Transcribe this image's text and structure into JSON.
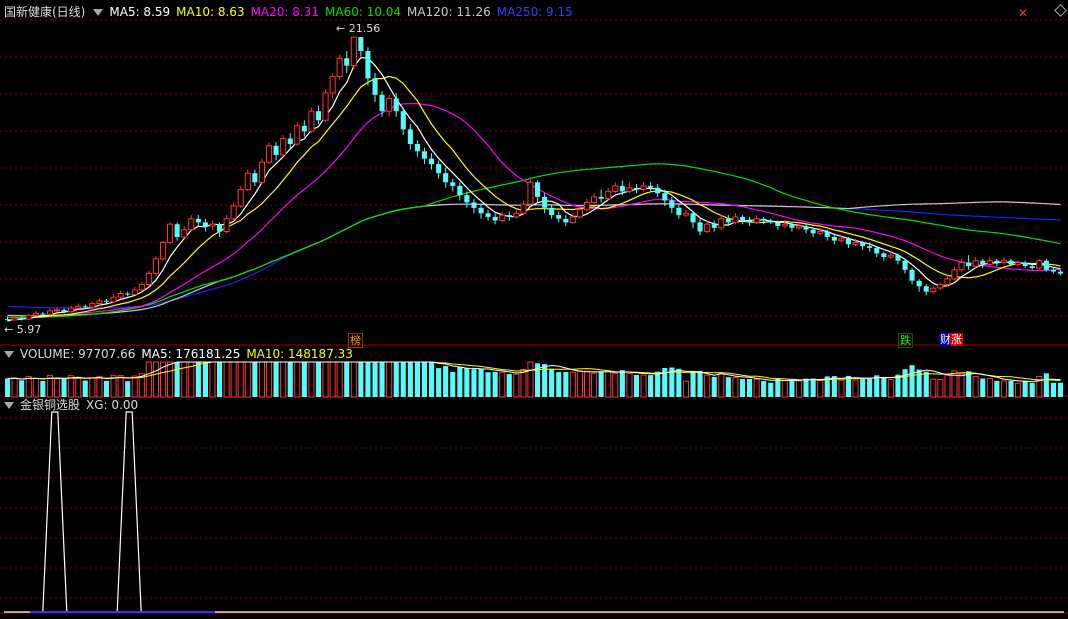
{
  "colors": {
    "up": "#ff3333",
    "down": "#54fcfc",
    "grid": "#7a0000",
    "ma5": "#ffffff",
    "ma10": "#ffff00",
    "ma20": "#ff00ff",
    "ma60": "#00e000",
    "ma120": "#c8c8c8",
    "ma250": "#2020ff",
    "xg": "#ffffff"
  },
  "icons": {
    "collapse": "triangle-down-icon",
    "close": "close-icon",
    "diamond": "diamond-icon"
  },
  "main_header": {
    "title": "国新健康(日线)",
    "ma5": "MA5: 8.59",
    "ma10": "MA10: 8.63",
    "ma20": "MA20: 8.31",
    "ma60": "MA60: 10.04",
    "ma120": "MA120: 11.26",
    "ma250": "MA250: 9.15"
  },
  "volume_header": {
    "title": "VOLUME: 97707.66",
    "ma5": "MA5: 176181.25",
    "ma10": "MA10: 148187.33"
  },
  "indicator_header": {
    "title": "金银铜选股",
    "xg": "XG: 0.00"
  },
  "annotations": {
    "high": "21.56",
    "low": "5.97",
    "tag_bang": "榜",
    "tag_die": "跌",
    "tag_cai": "财",
    "tag_zhang": "涨"
  },
  "chart_data": [
    {
      "type": "candlestick",
      "price_range": [
        5.5,
        22.5
      ],
      "high_label": 21.56,
      "low_label": 5.97,
      "candles": [
        [
          6.1,
          6.05,
          6.25,
          5.97
        ],
        [
          6.05,
          6.15,
          6.3,
          6.0
        ],
        [
          6.15,
          6.1,
          6.25,
          6.02
        ],
        [
          6.1,
          6.3,
          6.4,
          6.05
        ],
        [
          6.3,
          6.4,
          6.55,
          6.25
        ],
        [
          6.4,
          6.35,
          6.5,
          6.28
        ],
        [
          6.35,
          6.55,
          6.7,
          6.3
        ],
        [
          6.55,
          6.6,
          6.75,
          6.45
        ],
        [
          6.6,
          6.5,
          6.7,
          6.4
        ],
        [
          6.5,
          6.7,
          6.85,
          6.45
        ],
        [
          6.7,
          6.8,
          6.95,
          6.6
        ],
        [
          6.8,
          6.75,
          6.9,
          6.65
        ],
        [
          6.75,
          6.95,
          7.05,
          6.7
        ],
        [
          6.95,
          7.1,
          7.25,
          6.85
        ],
        [
          7.1,
          7.05,
          7.2,
          6.95
        ],
        [
          7.05,
          7.3,
          7.45,
          7.0
        ],
        [
          7.3,
          7.5,
          7.65,
          7.2
        ],
        [
          7.5,
          7.45,
          7.6,
          7.35
        ],
        [
          7.45,
          7.7,
          7.85,
          7.4
        ],
        [
          7.7,
          8.0,
          8.15,
          7.6
        ],
        [
          8.0,
          8.6,
          8.75,
          7.95
        ],
        [
          8.6,
          9.4,
          9.55,
          8.5
        ],
        [
          9.4,
          10.3,
          10.4,
          9.3
        ],
        [
          10.3,
          11.3,
          11.4,
          10.2
        ],
        [
          11.3,
          10.6,
          11.4,
          10.4
        ],
        [
          10.6,
          11.0,
          11.2,
          10.5
        ],
        [
          11.0,
          11.6,
          11.8,
          10.9
        ],
        [
          11.6,
          11.4,
          11.8,
          11.2
        ],
        [
          11.4,
          11.2,
          11.6,
          10.9
        ],
        [
          11.2,
          11.3,
          11.5,
          11.0
        ],
        [
          11.3,
          10.9,
          11.4,
          10.6
        ],
        [
          10.9,
          11.6,
          11.8,
          10.8
        ],
        [
          11.6,
          12.3,
          12.5,
          11.5
        ],
        [
          12.3,
          13.2,
          13.4,
          12.2
        ],
        [
          13.2,
          14.1,
          14.3,
          13.1
        ],
        [
          14.1,
          13.6,
          14.3,
          13.4
        ],
        [
          13.6,
          14.7,
          14.9,
          13.5
        ],
        [
          14.7,
          15.6,
          15.8,
          14.6
        ],
        [
          15.6,
          15.1,
          15.8,
          14.8
        ],
        [
          15.1,
          16.0,
          16.2,
          15.0
        ],
        [
          16.0,
          15.7,
          16.3,
          15.4
        ],
        [
          15.7,
          16.7,
          16.9,
          15.6
        ],
        [
          16.7,
          16.4,
          17.0,
          16.1
        ],
        [
          16.4,
          17.5,
          17.7,
          16.3
        ],
        [
          17.5,
          17.0,
          17.8,
          16.8
        ],
        [
          17.0,
          18.5,
          18.7,
          16.9
        ],
        [
          18.5,
          19.4,
          19.6,
          18.2
        ],
        [
          19.4,
          20.4,
          20.6,
          19.2
        ],
        [
          20.4,
          20.0,
          20.8,
          19.6
        ],
        [
          20.0,
          21.56,
          21.56,
          19.8
        ],
        [
          21.56,
          20.8,
          21.56,
          20.5
        ],
        [
          20.8,
          19.3,
          21.0,
          18.9
        ],
        [
          19.3,
          18.4,
          19.6,
          18.0
        ],
        [
          18.4,
          17.5,
          18.6,
          17.2
        ],
        [
          17.5,
          18.2,
          18.4,
          17.2
        ],
        [
          18.2,
          17.5,
          18.5,
          17.2
        ],
        [
          17.5,
          16.5,
          17.7,
          16.2
        ],
        [
          16.5,
          15.7,
          16.8,
          15.4
        ],
        [
          15.7,
          15.3,
          15.9,
          15.0
        ],
        [
          15.3,
          14.9,
          15.5,
          14.6
        ],
        [
          14.9,
          14.6,
          15.2,
          14.3
        ],
        [
          14.6,
          14.1,
          14.8,
          13.8
        ],
        [
          14.1,
          13.6,
          14.4,
          13.3
        ],
        [
          13.6,
          13.4,
          13.8,
          13.1
        ],
        [
          13.4,
          12.9,
          13.6,
          12.6
        ],
        [
          12.9,
          12.5,
          13.1,
          12.2
        ],
        [
          12.5,
          12.2,
          12.7,
          11.9
        ],
        [
          12.2,
          11.9,
          12.4,
          11.6
        ],
        [
          11.9,
          11.7,
          12.1,
          11.5
        ],
        [
          11.7,
          11.5,
          11.9,
          11.3
        ],
        [
          11.5,
          11.8,
          12.0,
          11.4
        ],
        [
          11.8,
          11.7,
          12.0,
          11.5
        ],
        [
          11.7,
          11.9,
          12.1,
          11.6
        ],
        [
          11.9,
          12.4,
          12.6,
          11.8
        ],
        [
          12.4,
          13.6,
          13.9,
          12.3
        ],
        [
          13.6,
          12.8,
          13.7,
          12.5
        ],
        [
          12.8,
          12.2,
          13.0,
          11.9
        ],
        [
          12.2,
          11.8,
          12.4,
          11.6
        ],
        [
          11.8,
          11.6,
          12.0,
          11.4
        ],
        [
          11.6,
          11.4,
          11.8,
          11.2
        ],
        [
          11.4,
          11.7,
          11.9,
          11.3
        ],
        [
          11.7,
          12.1,
          12.3,
          11.6
        ],
        [
          12.1,
          12.5,
          12.7,
          12.0
        ],
        [
          12.5,
          12.8,
          13.0,
          12.4
        ],
        [
          12.8,
          12.7,
          13.2,
          12.5
        ],
        [
          12.7,
          13.1,
          13.3,
          12.6
        ],
        [
          13.1,
          13.4,
          13.6,
          13.0
        ],
        [
          13.4,
          13.1,
          13.7,
          12.9
        ],
        [
          13.1,
          13.3,
          13.6,
          13.0
        ],
        [
          13.3,
          13.2,
          13.5,
          13.0
        ],
        [
          13.2,
          13.4,
          13.6,
          13.1
        ],
        [
          13.4,
          13.3,
          13.6,
          13.1
        ],
        [
          13.3,
          13.0,
          13.5,
          12.8
        ],
        [
          13.0,
          12.6,
          13.2,
          12.3
        ],
        [
          12.6,
          12.2,
          12.8,
          11.9
        ],
        [
          12.2,
          11.8,
          12.4,
          11.6
        ],
        [
          11.8,
          11.9,
          12.1,
          11.7
        ],
        [
          11.9,
          11.4,
          12.0,
          11.1
        ],
        [
          11.4,
          10.9,
          11.6,
          10.7
        ],
        [
          10.9,
          11.3,
          11.5,
          10.8
        ],
        [
          11.3,
          11.1,
          11.5,
          10.9
        ],
        [
          11.1,
          11.6,
          11.8,
          11.0
        ],
        [
          11.6,
          11.4,
          11.8,
          11.2
        ],
        [
          11.4,
          11.7,
          11.9,
          11.3
        ],
        [
          11.7,
          11.5,
          11.8,
          11.3
        ],
        [
          11.5,
          11.4,
          11.7,
          11.2
        ],
        [
          11.4,
          11.6,
          11.8,
          11.3
        ],
        [
          11.6,
          11.5,
          11.7,
          11.3
        ],
        [
          11.5,
          11.4,
          11.6,
          11.3
        ],
        [
          11.4,
          11.2,
          11.5,
          11.0
        ],
        [
          11.2,
          11.3,
          11.5,
          11.1
        ],
        [
          11.3,
          11.1,
          11.4,
          10.9
        ],
        [
          11.1,
          11.2,
          11.4,
          11.0
        ],
        [
          11.2,
          11.0,
          11.3,
          10.8
        ],
        [
          11.0,
          10.8,
          11.1,
          10.6
        ],
        [
          10.8,
          10.9,
          11.1,
          10.7
        ],
        [
          10.9,
          10.6,
          11.0,
          10.4
        ],
        [
          10.6,
          10.4,
          10.8,
          10.2
        ],
        [
          10.4,
          10.5,
          10.7,
          10.3
        ],
        [
          10.5,
          10.2,
          10.6,
          10.0
        ],
        [
          10.2,
          10.3,
          10.5,
          10.1
        ],
        [
          10.3,
          10.1,
          10.4,
          9.9
        ],
        [
          10.1,
          10.0,
          10.3,
          9.8
        ],
        [
          10.0,
          9.7,
          10.1,
          9.5
        ],
        [
          9.7,
          9.5,
          9.8,
          9.3
        ],
        [
          9.5,
          9.6,
          9.8,
          9.4
        ],
        [
          9.6,
          9.3,
          9.7,
          9.1
        ],
        [
          9.3,
          8.8,
          9.4,
          8.6
        ],
        [
          8.8,
          8.2,
          8.9,
          8.0
        ],
        [
          8.2,
          7.9,
          8.3,
          7.6
        ],
        [
          7.9,
          7.6,
          8.0,
          7.4
        ],
        [
          7.6,
          7.8,
          7.9,
          7.5
        ],
        [
          7.8,
          8.0,
          8.1,
          7.7
        ],
        [
          8.0,
          8.3,
          8.5,
          7.9
        ],
        [
          8.3,
          8.8,
          9.0,
          8.2
        ],
        [
          8.8,
          9.2,
          9.4,
          8.7
        ],
        [
          9.2,
          9.0,
          9.6,
          8.8
        ],
        [
          9.0,
          9.3,
          9.5,
          8.9
        ],
        [
          9.3,
          9.1,
          9.4,
          8.9
        ],
        [
          9.1,
          9.3,
          9.5,
          9.0
        ],
        [
          9.3,
          9.2,
          9.4,
          9.0
        ],
        [
          9.2,
          9.3,
          9.5,
          9.1
        ],
        [
          9.3,
          9.1,
          9.4,
          9.0
        ],
        [
          9.1,
          9.2,
          9.3,
          9.0
        ],
        [
          9.2,
          9.0,
          9.3,
          8.9
        ],
        [
          9.0,
          8.9,
          9.1,
          8.8
        ],
        [
          8.9,
          9.3,
          9.4,
          8.8
        ],
        [
          9.3,
          8.8,
          9.4,
          8.7
        ],
        [
          8.8,
          8.7,
          8.9,
          8.6
        ],
        [
          8.7,
          8.59,
          8.8,
          8.5
        ]
      ]
    },
    {
      "type": "bar",
      "name": "VOLUME",
      "value": 97707.66,
      "ma5": 176181.25,
      "ma10": 148187.33
    },
    {
      "type": "line",
      "name": "XG",
      "value": 0.0,
      "signals_at": [
        4,
        16
      ],
      "ylim": [
        0,
        1
      ]
    }
  ]
}
